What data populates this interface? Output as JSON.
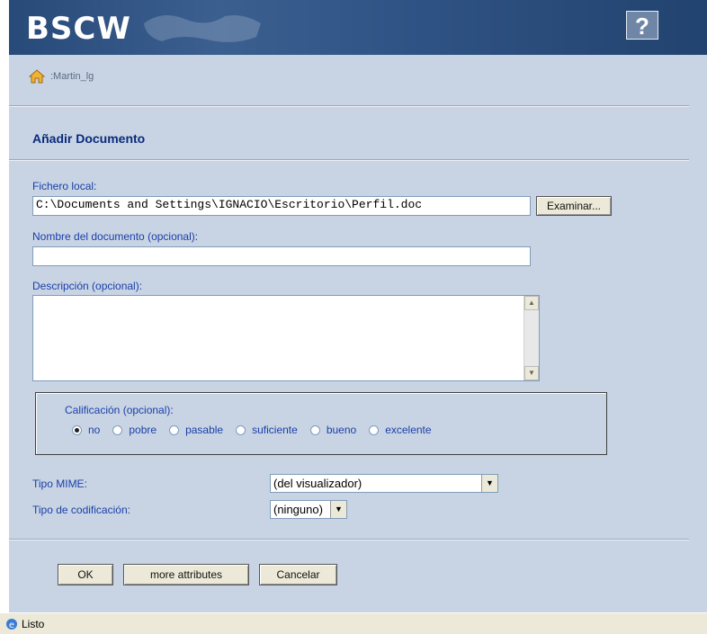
{
  "header": {
    "logo": "BSCW",
    "help_label": "?"
  },
  "breadcrumb": {
    "path": ":Martin_lg"
  },
  "page_title": "Añadir Documento",
  "local_file": {
    "label": "Fichero local:",
    "value": "C:\\Documents and Settings\\IGNACIO\\Escritorio\\Perfil.doc",
    "browse_label": "Examinar..."
  },
  "doc_name": {
    "label": "Nombre del documento (opcional):",
    "value": ""
  },
  "description": {
    "label": "Descripción (opcional):",
    "value": ""
  },
  "rating": {
    "label": "Calificación (opcional):",
    "options": [
      "no",
      "pobre",
      "pasable",
      "suficiente",
      "bueno",
      "excelente"
    ],
    "selected": "no"
  },
  "mime": {
    "label": "Tipo MIME:",
    "value": "(del visualizador)"
  },
  "encoding": {
    "label": "Tipo de codificación:",
    "value": "(ninguno)"
  },
  "buttons": {
    "ok": "OK",
    "more": "more attributes",
    "cancel": "Cancelar"
  },
  "status": {
    "text": "Listo"
  }
}
